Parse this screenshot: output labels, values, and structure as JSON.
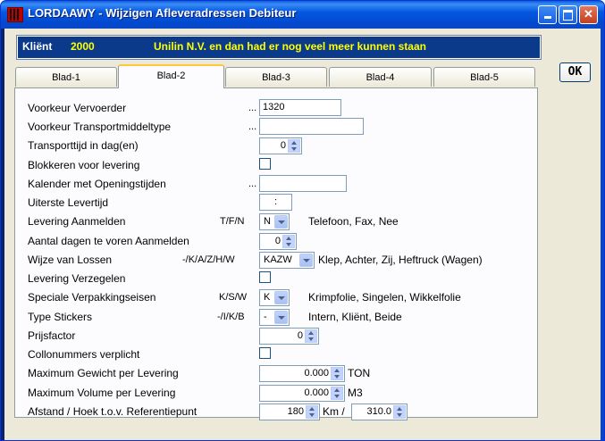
{
  "window": {
    "title": "LORDAAWY - Wijzigen Afleveradressen Debiteur"
  },
  "klient": {
    "label": "Kliënt",
    "number": "2000",
    "name": "Unilin N.V. en dan had er nog veel meer kunnen staan"
  },
  "tabs": [
    "Blad-1",
    "Blad-2",
    "Blad-3",
    "Blad-4",
    "Blad-5"
  ],
  "active_tab": "Blad-2",
  "ok_label": "OK",
  "fields": {
    "voorkeur_vervoerder": {
      "label": "Voorkeur Vervoerder",
      "dots": "...",
      "value": "1320"
    },
    "voorkeur_transport": {
      "label": "Voorkeur Transportmiddeltype",
      "dots": "...",
      "value": ""
    },
    "transporttijd": {
      "label": "Transporttijd in dag(en)",
      "value": "0"
    },
    "blokkeren": {
      "label": "Blokkeren voor levering"
    },
    "kalender": {
      "label": "Kalender met Openingstijden",
      "dots": "...",
      "value": ""
    },
    "uiterste": {
      "label": "Uiterste Levertijd",
      "value": ":"
    },
    "levering_aanmelden": {
      "label": "Levering Aanmelden",
      "code": "T/F/N",
      "value": "N",
      "desc": "Telefoon, Fax, Nee"
    },
    "aantal_dagen": {
      "label": "Aantal dagen te voren Aanmelden",
      "value": "0"
    },
    "wijze_lossen": {
      "label": "Wijze van Lossen",
      "code": "-/K/A/Z/H/W",
      "value": "KAZW",
      "desc": "Klep, Achter, Zij, Heftruck (Wagen)"
    },
    "verzegelen": {
      "label": "Levering Verzegelen"
    },
    "verpakking": {
      "label": "Speciale Verpakkingseisen",
      "code": "K/S/W",
      "value": "K",
      "desc": "Krimpfolie, Singelen, Wikkelfolie"
    },
    "stickers": {
      "label": "Type Stickers",
      "code": "-/I/K/B",
      "value": "-",
      "desc": "Intern, Kliënt, Beide"
    },
    "prijsfactor": {
      "label": "Prijsfactor",
      "value": "0"
    },
    "collonummers": {
      "label": "Collonummers verplicht"
    },
    "max_gewicht": {
      "label": "Maximum Gewicht per Levering",
      "value": "0.000",
      "unit": "TON"
    },
    "max_volume": {
      "label": "Maximum Volume  per Levering",
      "value": "0.000",
      "unit": "M3"
    },
    "afstand": {
      "label": "Afstand / Hoek t.o.v. Referentiepunt",
      "value": "180",
      "unit": "Km /",
      "value2": "310.0"
    }
  },
  "colors": {
    "title_bar": "#0458e0",
    "klient_bar": "#0b3a8a",
    "klient_label": "#ffffff",
    "klient_text": "#ffff00",
    "tab_highlight": "#ffc83c"
  }
}
